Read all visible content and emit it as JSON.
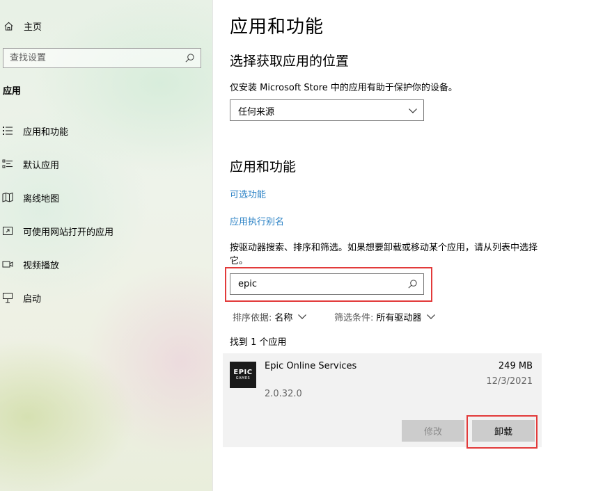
{
  "sidebar": {
    "home_label": "主页",
    "search_placeholder": "查找设置",
    "section_label": "应用",
    "items": [
      {
        "label": "应用和功能",
        "icon": "apps-features-icon"
      },
      {
        "label": "默认应用",
        "icon": "default-apps-icon"
      },
      {
        "label": "离线地图",
        "icon": "offline-maps-icon"
      },
      {
        "label": "可使用网站打开的应用",
        "icon": "apps-for-websites-icon"
      },
      {
        "label": "视频播放",
        "icon": "video-playback-icon"
      },
      {
        "label": "启动",
        "icon": "startup-icon"
      }
    ]
  },
  "main": {
    "page_title": "应用和功能",
    "install_source": {
      "heading": "选择获取应用的位置",
      "description": "仅安装 Microsoft Store 中的应用有助于保护你的设备。",
      "dropdown_value": "任何来源"
    },
    "apps_section": {
      "heading": "应用和功能",
      "link_optional_features": "可选功能",
      "link_execution_aliases": "应用执行别名",
      "instructions": "按驱动器搜索、排序和筛选。如果想要卸载或移动某个应用，请从列表中选择它。",
      "search_value": "epic",
      "sort_label": "排序依据:",
      "sort_value": "名称",
      "filter_label": "筛选条件:",
      "filter_value": "所有驱动器",
      "found_text": "找到 1 个应用"
    },
    "app": {
      "logo_line1": "EPIC",
      "logo_line2": "GAMES",
      "name": "Epic Online Services",
      "size": "249 MB",
      "date": "12/3/2021",
      "version": "2.0.32.0",
      "modify_label": "修改",
      "uninstall_label": "卸载"
    }
  },
  "colors": {
    "link": "#2d83c6",
    "highlight": "#e23a3a",
    "card_bg": "#f2f2f2",
    "button_bg": "#cccccc"
  }
}
